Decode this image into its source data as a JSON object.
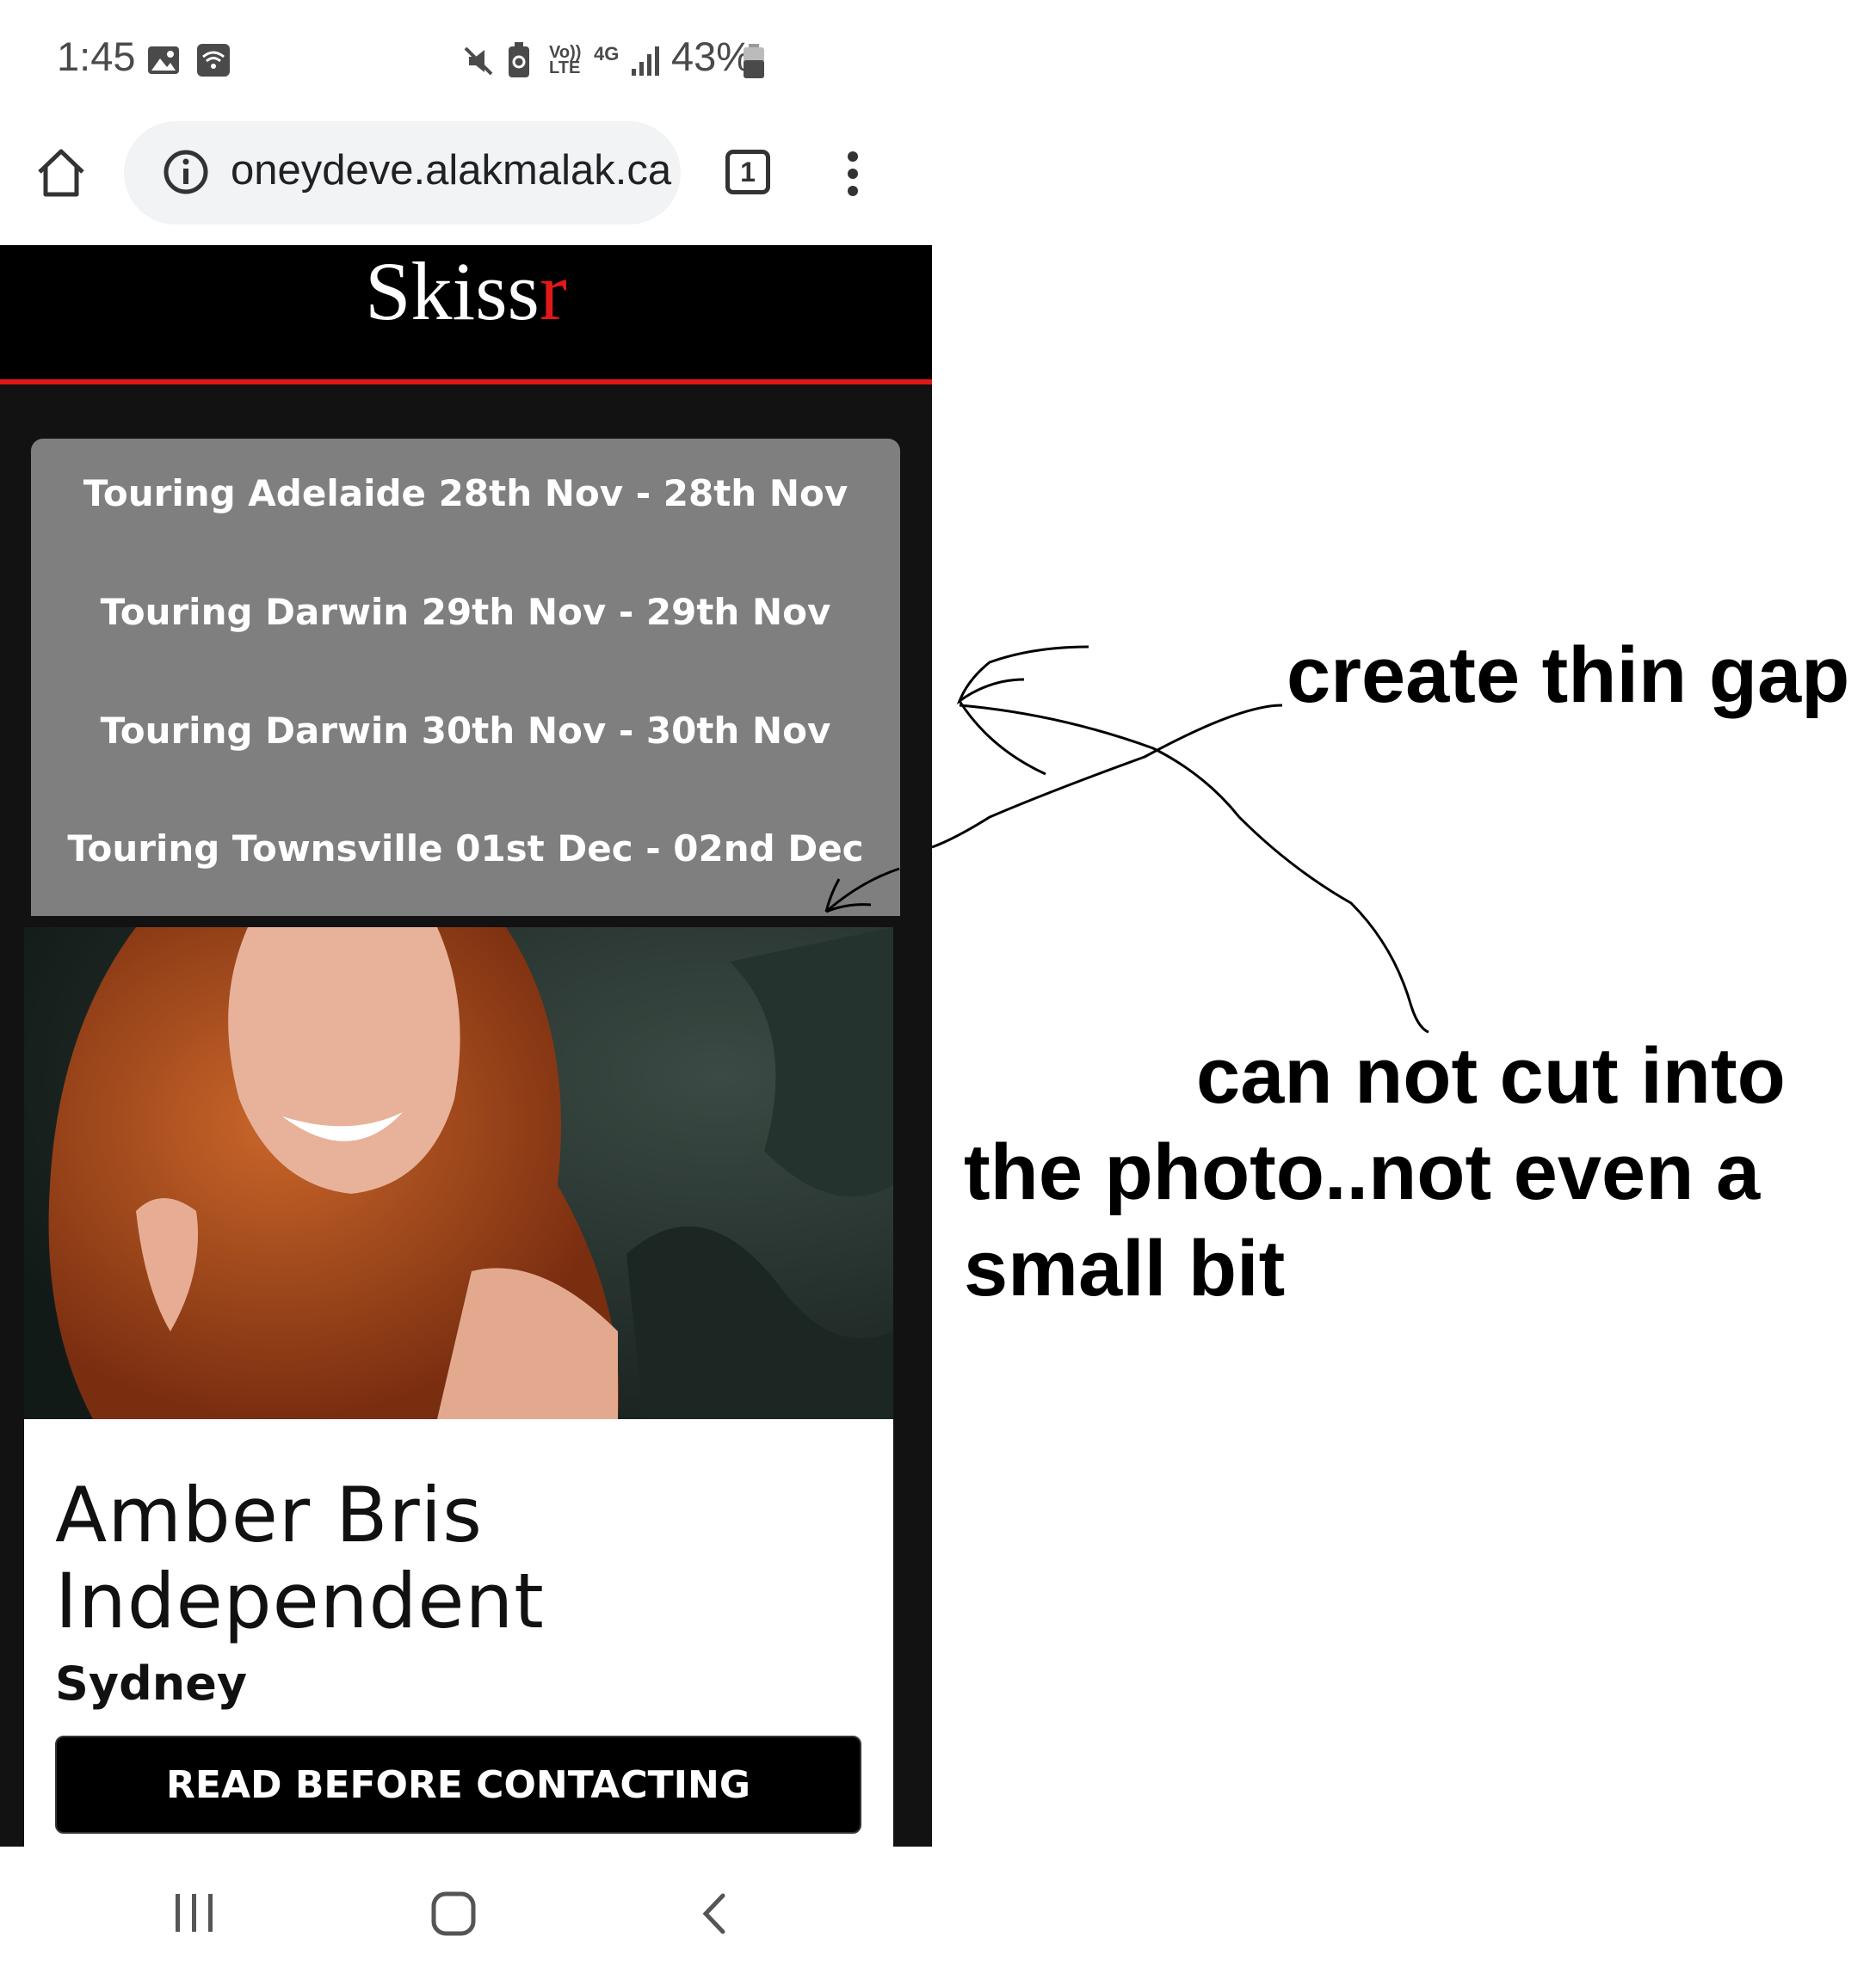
{
  "status_bar": {
    "time": "1:45",
    "battery_percent": "43%",
    "icons": [
      "gallery-icon",
      "wifi-icon",
      "mute-icon",
      "battery-saver-icon",
      "volte-icon",
      "4g-icon",
      "signal-icon",
      "battery-icon"
    ],
    "volte_label": "Vo)) LTE",
    "net_label": "4G"
  },
  "browser": {
    "url": "oneydeve.alakmalak.ca",
    "tab_count": "1"
  },
  "site": {
    "logo_main": "Skiss",
    "logo_accent": "r",
    "tours": [
      "Touring Adelaide 28th Nov - 28th Nov",
      "Touring Darwin 29th Nov - 29th Nov",
      "Touring Darwin 30th Nov - 30th Nov",
      "Touring Townsville 01st Dec - 02nd Dec"
    ],
    "profile": {
      "name_line1": "Amber Bris",
      "name_line2": "Independent",
      "city": "Sydney",
      "cta": "READ BEFORE CONTACTING"
    }
  },
  "annotations": {
    "top": "create thin gap",
    "bottom_line1": "can not cut into",
    "bottom_line2": "the photo..not even a",
    "bottom_line3": "small bit"
  },
  "colors": {
    "accent_red": "#e01818",
    "panel_gray": "#7f7f7f",
    "header_black": "#000000"
  }
}
